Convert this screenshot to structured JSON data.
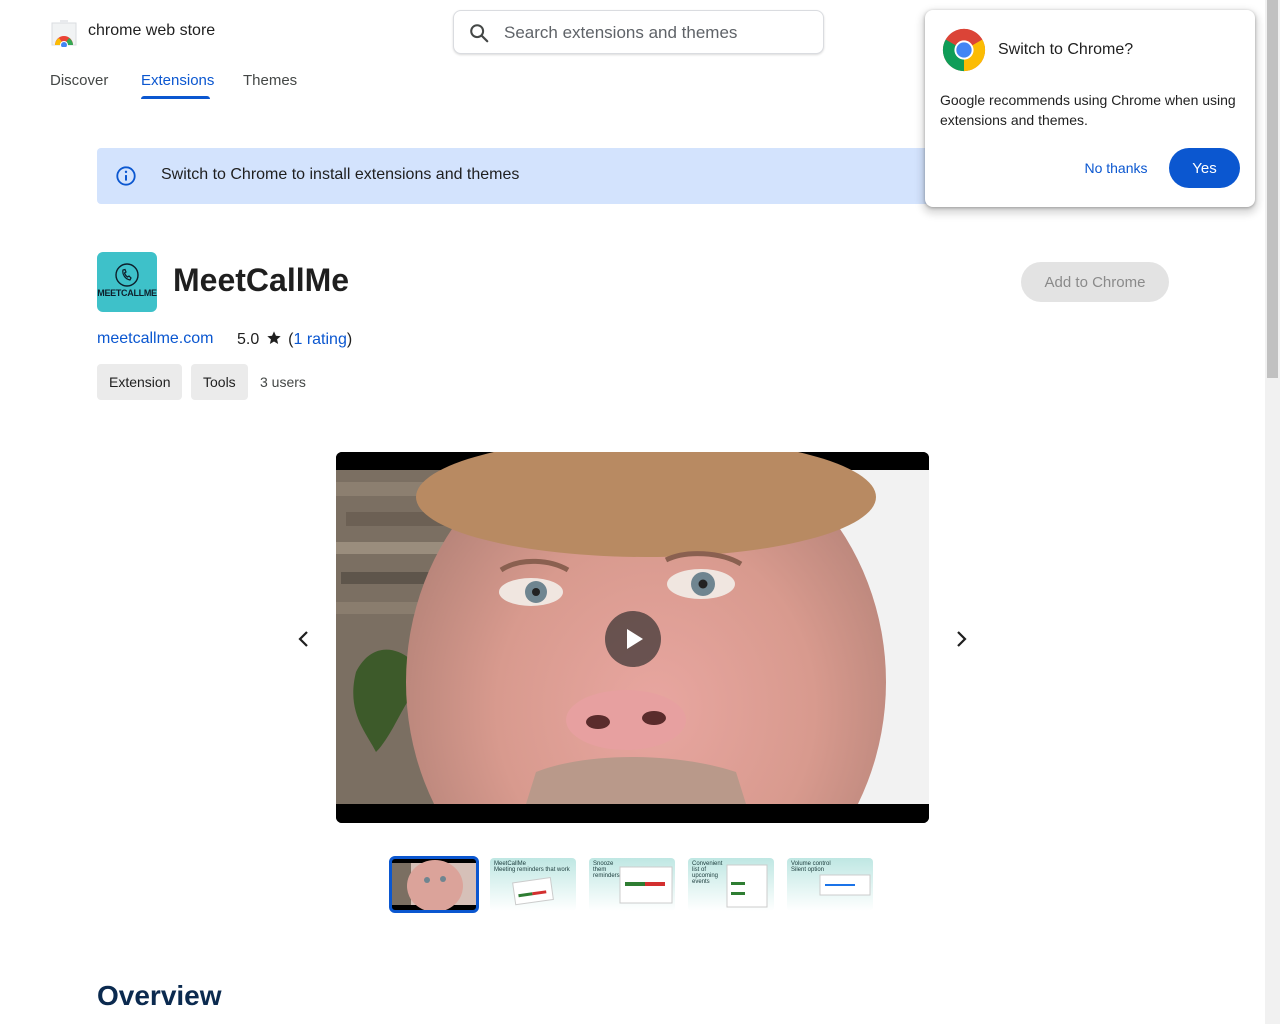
{
  "header": {
    "store_name": "chrome web store",
    "search_placeholder": "Search extensions and themes"
  },
  "tabs": [
    {
      "label": "Discover"
    },
    {
      "label": "Extensions",
      "active": true
    },
    {
      "label": "Themes"
    }
  ],
  "banner": {
    "text": "Switch to Chrome to install extensions and themes"
  },
  "popup": {
    "title": "Switch to Chrome?",
    "body": "Google recommends using Chrome when using extensions and themes.",
    "no_label": "No thanks",
    "yes_label": "Yes"
  },
  "extension": {
    "icon_text": "MEETCALLME",
    "name": "MeetCallMe",
    "add_label": "Add to Chrome",
    "website": "meetcallme.com",
    "rating_value": "5.0",
    "rating_open": "(",
    "rating_count": "1 rating",
    "rating_close": ")",
    "chips": [
      "Extension",
      "Tools"
    ],
    "users": "3 users"
  },
  "thumbnails": [
    {
      "text": ""
    },
    {
      "text": "MeetCallMe\nMeeting reminders that work"
    },
    {
      "text": "Snooze them reminders"
    },
    {
      "text": "Convenient list of upcoming events"
    },
    {
      "text": "Volume control\nSilent option"
    }
  ],
  "overview": {
    "heading": "Overview"
  },
  "colors": {
    "accent": "#0b57d0",
    "banner_bg": "#d3e3fd",
    "icon_bg": "#3ec1c9"
  }
}
